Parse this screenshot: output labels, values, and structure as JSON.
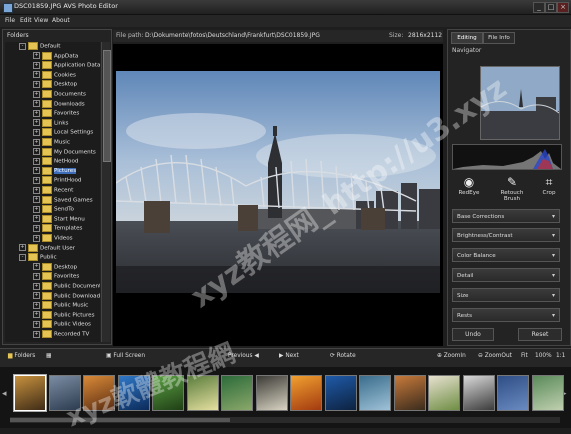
{
  "window": {
    "title": "DSC01859.JPG  AVS Photo Editor",
    "minimize": "_",
    "maximize": "□",
    "close": "×"
  },
  "menu": {
    "file": "File",
    "edit": "Edit",
    "view": "View",
    "about": "About"
  },
  "folders": {
    "header": "Folders",
    "items": [
      {
        "label": "Default",
        "level": 1,
        "toggle": "-"
      },
      {
        "label": "AppData",
        "level": 2,
        "toggle": "+"
      },
      {
        "label": "Application Data",
        "level": 2,
        "toggle": "+"
      },
      {
        "label": "Cookies",
        "level": 2,
        "toggle": "+"
      },
      {
        "label": "Desktop",
        "level": 2,
        "toggle": "+"
      },
      {
        "label": "Documents",
        "level": 2,
        "toggle": "+"
      },
      {
        "label": "Downloads",
        "level": 2,
        "toggle": "+"
      },
      {
        "label": "Favorites",
        "level": 2,
        "toggle": "+"
      },
      {
        "label": "Links",
        "level": 2,
        "toggle": "+"
      },
      {
        "label": "Local Settings",
        "level": 2,
        "toggle": "+"
      },
      {
        "label": "Music",
        "level": 2,
        "toggle": "+"
      },
      {
        "label": "My Documents",
        "level": 2,
        "toggle": "+"
      },
      {
        "label": "NetHood",
        "level": 2,
        "toggle": "+"
      },
      {
        "label": "Pictures",
        "level": 2,
        "toggle": "+",
        "selected": true
      },
      {
        "label": "PrintHood",
        "level": 2,
        "toggle": "+"
      },
      {
        "label": "Recent",
        "level": 2,
        "toggle": "+"
      },
      {
        "label": "Saved Games",
        "level": 2,
        "toggle": "+"
      },
      {
        "label": "SendTo",
        "level": 2,
        "toggle": "+"
      },
      {
        "label": "Start Menu",
        "level": 2,
        "toggle": "+"
      },
      {
        "label": "Templates",
        "level": 2,
        "toggle": "+"
      },
      {
        "label": "Videos",
        "level": 2,
        "toggle": "+"
      },
      {
        "label": "Default User",
        "level": 1,
        "toggle": "+"
      },
      {
        "label": "Public",
        "level": 1,
        "toggle": "-"
      },
      {
        "label": "Desktop",
        "level": 2,
        "toggle": "+"
      },
      {
        "label": "Favorites",
        "level": 2,
        "toggle": "+"
      },
      {
        "label": "Public Documents",
        "level": 2,
        "toggle": "+"
      },
      {
        "label": "Public Downloads",
        "level": 2,
        "toggle": "+"
      },
      {
        "label": "Public Music",
        "level": 2,
        "toggle": "+"
      },
      {
        "label": "Public Pictures",
        "level": 2,
        "toggle": "+"
      },
      {
        "label": "Public Videos",
        "level": 2,
        "toggle": "+"
      },
      {
        "label": "Recorded TV",
        "level": 2,
        "toggle": "+"
      }
    ]
  },
  "info": {
    "path_label": "File path:",
    "path_value": "D:\\Dokumente\\fotos\\Deutschland\\Frankfurt\\DSC01859.JPG",
    "size_label": "Size:",
    "size_value": "2816x2112"
  },
  "right_panel": {
    "tabs": [
      "Editing",
      "File Info"
    ],
    "navigator": "Navigator",
    "tools": [
      "RedEye",
      "Retouch Brush",
      "Crop"
    ],
    "dropdowns": [
      "Base Corrections",
      "Brightness/Contrast",
      "Color Balance",
      "Detail",
      "Size",
      "Rests"
    ],
    "undo": "Undo",
    "reset": "Reset"
  },
  "toolbar": {
    "folders": "Folders",
    "fullscreen": "Full Screen",
    "previous": "Previous",
    "next": "Next",
    "rotate": "Rotate",
    "zoom_in": "ZoomIn",
    "zoom_out": "ZoomOut",
    "fit": "Fit",
    "zoom_value": "100%",
    "ratio": "1:1"
  },
  "filmstrip": {
    "left_arrow": "◂",
    "right_arrow": "▸",
    "thumbs": [
      {
        "colors": [
          "#c7913e",
          "#3f2c17"
        ]
      },
      {
        "colors": [
          "#7b8da3",
          "#2c3b4f"
        ]
      },
      {
        "colors": [
          "#d98a38",
          "#5b2d12"
        ]
      },
      {
        "colors": [
          "#2f78c8",
          "#0c2b5a"
        ]
      },
      {
        "colors": [
          "#5ca044",
          "#1f3f15"
        ]
      },
      {
        "colors": [
          "#5b7d3d",
          "#e5e0a0"
        ]
      },
      {
        "colors": [
          "#2c6b3a",
          "#8ba86a"
        ]
      },
      {
        "colors": [
          "#3c3b36",
          "#d9d4c3"
        ]
      },
      {
        "colors": [
          "#f0a030",
          "#a33a10"
        ]
      },
      {
        "colors": [
          "#1f5aa8",
          "#0d2240"
        ]
      },
      {
        "colors": [
          "#3a6d8c",
          "#9fc2d8"
        ]
      },
      {
        "colors": [
          "#c87a3b",
          "#3a2b1d"
        ]
      },
      {
        "colors": [
          "#e7e1d0",
          "#6f8e44"
        ]
      },
      {
        "colors": [
          "#d9d9d9",
          "#3b3b3b"
        ]
      },
      {
        "colors": [
          "#2e4e85",
          "#6a8bc2"
        ]
      },
      {
        "colors": [
          "#5a8a5a",
          "#c0d0b0"
        ]
      }
    ]
  },
  "watermark": {
    "text1": "xyz教程网_http://u3.xyz",
    "text2": "xyz軟體教程網"
  },
  "colors": {
    "selection": "#3d6db8",
    "folder": "#e6c454",
    "panel": "#232323"
  }
}
